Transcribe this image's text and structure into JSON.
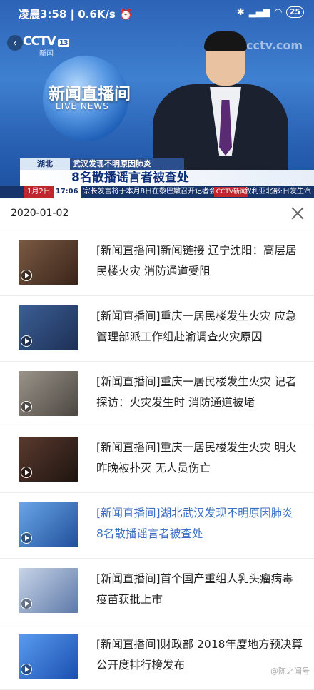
{
  "status_bar": {
    "time": "凌晨3:58",
    "network_speed": "0.6K/s",
    "battery": "25"
  },
  "player": {
    "channel": "CCTV",
    "channel_number": "13",
    "channel_sub": "新闻",
    "watermark": "cctv.com",
    "program_title": "新闻直播间",
    "program_en": "LIVE NEWS",
    "lower_third": {
      "region": "湖北",
      "tag": "武汉发现不明原因肺炎",
      "headline": "8名散播谣言者被查处"
    },
    "ticker": {
      "date": "1月2日",
      "time": "17:06",
      "text": "宗长发言将于本月8日在黎巴嫩召开记者会。",
      "logo": "CCTV新闻",
      "right": "叙利亚北部:日发生汽"
    }
  },
  "header": {
    "date": "2020-01-02"
  },
  "playlist": [
    {
      "title": "[新闻直播间]新闻链接 辽宁沈阳：高层居民楼火灾 消防通道受阻",
      "active": false,
      "thumb_color": "#5a3a2a"
    },
    {
      "title": "[新闻直播间]重庆一居民楼发生火灾 应急管理部派工作组赴渝调查火灾原因",
      "active": false,
      "thumb_color": "#2b4a78"
    },
    {
      "title": "[新闻直播间]重庆一居民楼发生火灾 记者探访：火灾发生时 消防通道被堵",
      "active": false,
      "thumb_color": "#6f6a62"
    },
    {
      "title": "[新闻直播间]重庆一居民楼发生火灾 明火昨晚被扑灭 无人员伤亡",
      "active": false,
      "thumb_color": "#3a2c26"
    },
    {
      "title": "[新闻直播间]湖北武汉发现不明原因肺炎 8名散播谣言者被查处",
      "active": true,
      "thumb_color": "#3b78c8"
    },
    {
      "title": "[新闻直播间]首个国产重组人乳头瘤病毒疫苗获批上市",
      "active": false,
      "thumb_color": "#8aa0c4"
    },
    {
      "title": "[新闻直播间]财政部 2018年度地方预决算公开度排行榜发布",
      "active": false,
      "thumb_color": "#2a6bd0"
    }
  ],
  "corner_watermark": "@陈之闻号"
}
